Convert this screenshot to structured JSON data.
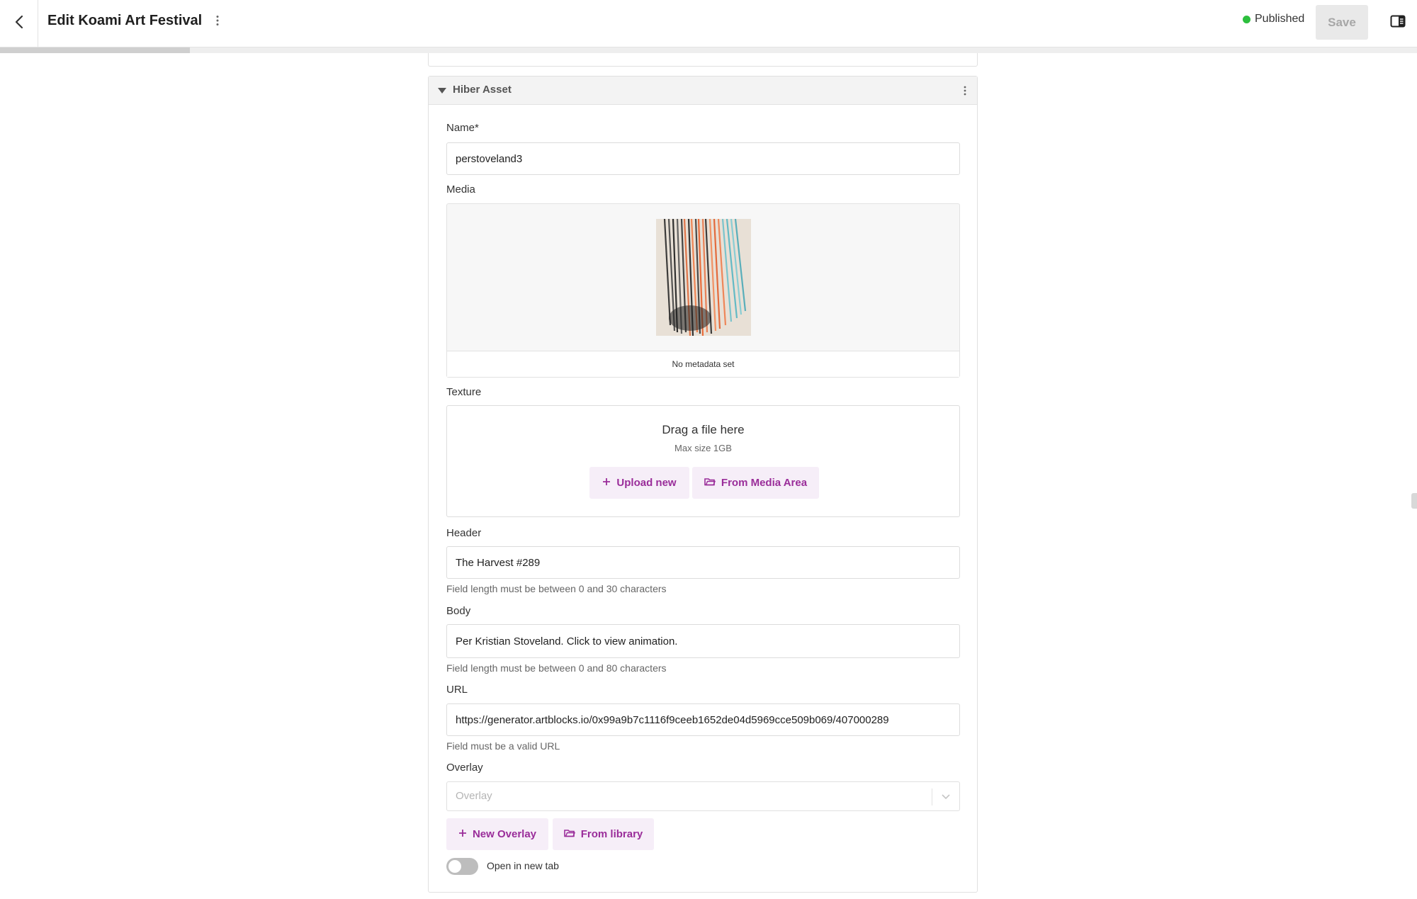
{
  "header": {
    "title": "Edit Koami Art Festival",
    "status_text": "Published",
    "status_color": "#2cbf3d",
    "save_label": "Save",
    "back_icon": "chevron-left-icon",
    "menu_icon": "kebab-menu-icon",
    "panel_icon": "sidebar-panel-icon"
  },
  "progress": {
    "fraction": 0.134
  },
  "card": {
    "title": "Hiber Asset",
    "fields": {
      "name": {
        "label": "Name*",
        "value": "perstoveland3"
      },
      "media": {
        "label": "Media",
        "metadata_text": "No metadata set"
      },
      "texture": {
        "label": "Texture",
        "drop_title": "Drag a file here",
        "drop_subtitle": "Max size 1GB",
        "upload_label": "Upload new",
        "media_area_label": "From Media Area"
      },
      "header": {
        "label": "Header",
        "value": "The Harvest #289",
        "helper": "Field length must be between 0 and 30 characters"
      },
      "body": {
        "label": "Body",
        "value": "Per Kristian Stoveland. Click to view animation.",
        "helper": "Field length must be between 0 and 80 characters"
      },
      "url": {
        "label": "URL",
        "value": "https://generator.artblocks.io/0x99a9b7c1116f9ceeb1652de04d5969cce509b069/407000289",
        "helper": "Field must be a valid URL"
      },
      "overlay": {
        "label": "Overlay",
        "placeholder": "Overlay",
        "new_label": "New Overlay",
        "library_label": "From library"
      },
      "open_new_tab": {
        "label": "Open in new tab",
        "checked": false
      }
    }
  },
  "accent_color": "#9a2d9a"
}
